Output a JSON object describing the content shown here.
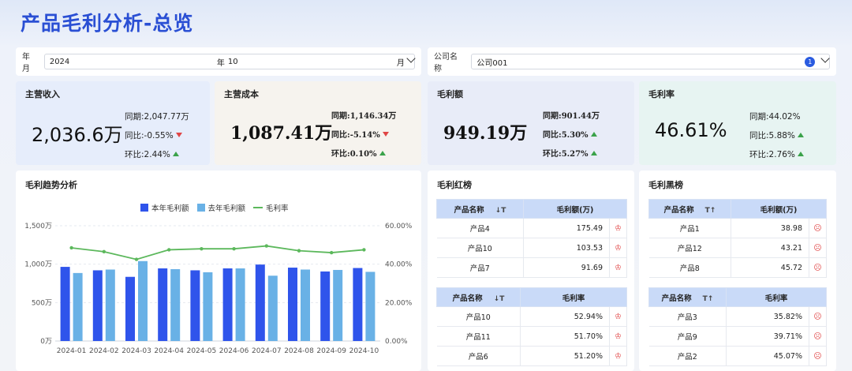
{
  "title": "产品毛利分析-总览",
  "filters": {
    "ym_label": "年月",
    "year": "2024",
    "year_suffix": "年",
    "month": "10",
    "month_suffix": "月",
    "company_label": "公司名称",
    "company": "公司001",
    "company_count": "1"
  },
  "kpis": [
    {
      "label": "主营收入",
      "value": "2,036.6万",
      "yoy_base_label": "同期:",
      "yoy_base": "2,047.77万",
      "yoy_label": "同比:",
      "yoy": "-0.55%",
      "yoy_dir": "down",
      "mom_label": "环比:",
      "mom": "2.44%",
      "mom_dir": "up"
    },
    {
      "label": "主营成本",
      "value": "1,087.41万",
      "yoy_base_label": "同期:",
      "yoy_base": "1,146.34万",
      "yoy_label": "同比:",
      "yoy": "-5.14%",
      "yoy_dir": "down",
      "mom_label": "环比:",
      "mom": "0.10%",
      "mom_dir": "up"
    },
    {
      "label": "毛利额",
      "value": "949.19万",
      "yoy_base_label": "同期:",
      "yoy_base": "901.44万",
      "yoy_label": "同比:",
      "yoy": "5.30%",
      "yoy_dir": "up",
      "mom_label": "环比:",
      "mom": "5.27%",
      "mom_dir": "up"
    },
    {
      "label": "毛利率",
      "value": "46.61%",
      "yoy_base_label": "同期:",
      "yoy_base": "44.02%",
      "yoy_label": "同比:",
      "yoy": "5.88%",
      "yoy_dir": "up",
      "mom_label": "环比:",
      "mom": "2.76%",
      "mom_dir": "up"
    }
  ],
  "trend": {
    "title": "毛利趋势分析"
  },
  "chart_data": {
    "type": "bar",
    "categories": [
      "2024-01",
      "2024-02",
      "2024-03",
      "2024-04",
      "2024-05",
      "2024-06",
      "2024-07",
      "2024-08",
      "2024-09",
      "2024-10"
    ],
    "series": [
      {
        "name": "本年毛利额",
        "type": "bar",
        "axis": "left",
        "color": "#2f54eb",
        "values": [
          965,
          920,
          835,
          945,
          920,
          945,
          995,
          955,
          905,
          950
        ]
      },
      {
        "name": "去年毛利额",
        "type": "bar",
        "axis": "left",
        "color": "#69b1e6",
        "values": [
          885,
          930,
          1040,
          935,
          895,
          945,
          850,
          930,
          925,
          900
        ]
      },
      {
        "name": "毛利率",
        "type": "line",
        "axis": "right",
        "color": "#5cb85c",
        "values": [
          48.5,
          46.5,
          42.5,
          47.5,
          48,
          48,
          49.5,
          47,
          46,
          47.5
        ]
      }
    ],
    "ylim": [
      0,
      1500
    ],
    "y_ticks": [
      "0万",
      "500万",
      "1,000万",
      "1,500万"
    ],
    "y2lim": [
      0,
      60
    ],
    "y2_ticks": [
      "0.00%",
      "20.00%",
      "40.00%",
      "60.00%"
    ],
    "legend": "top-center",
    "grid": true
  },
  "red_list": {
    "title": "毛利红榜",
    "table1": {
      "headers": [
        "产品名称",
        "毛利额(万)"
      ],
      "rows": [
        [
          "产品4",
          "175.49"
        ],
        [
          "产品10",
          "103.53"
        ],
        [
          "产品7",
          "91.69"
        ]
      ]
    },
    "table2": {
      "headers": [
        "产品名称",
        "毛利率"
      ],
      "rows": [
        [
          "产品10",
          "52.94%"
        ],
        [
          "产品11",
          "51.70%"
        ],
        [
          "产品6",
          "51.20%"
        ]
      ]
    }
  },
  "black_list": {
    "title": "毛利黑榜",
    "table1": {
      "headers": [
        "产品名称",
        "毛利额(万)"
      ],
      "rows": [
        [
          "产品1",
          "38.98"
        ],
        [
          "产品12",
          "43.21"
        ],
        [
          "产品8",
          "45.72"
        ]
      ]
    },
    "table2": {
      "headers": [
        "产品名称",
        "毛利率"
      ],
      "rows": [
        [
          "产品3",
          "35.82%"
        ],
        [
          "产品9",
          "39.71%"
        ],
        [
          "产品2",
          "45.07%"
        ]
      ]
    }
  }
}
